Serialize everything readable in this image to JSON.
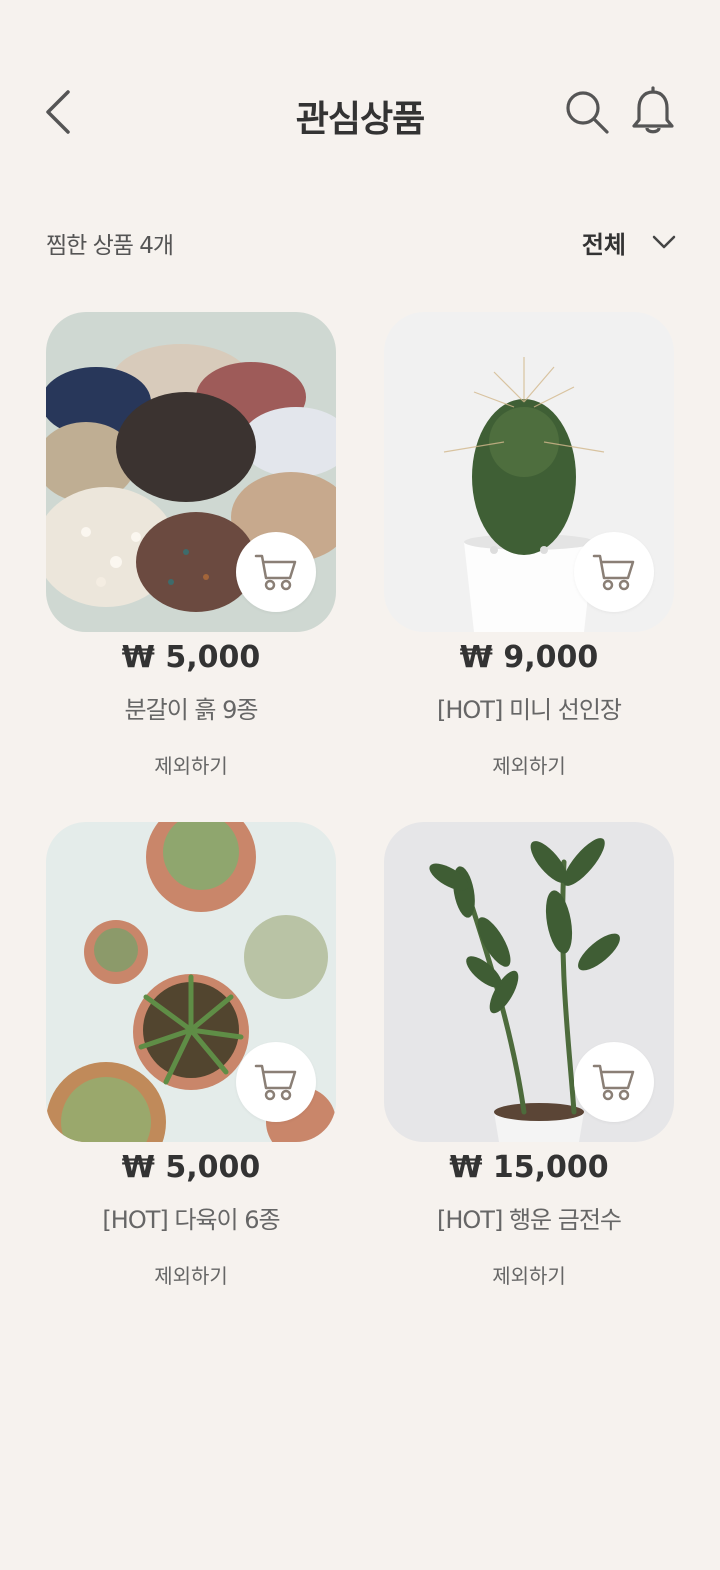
{
  "header": {
    "title": "관심상품",
    "back_icon": "chevron-left-icon",
    "search_icon": "search-icon",
    "notification_icon": "bell-icon"
  },
  "summary": {
    "count_text": "찜한 상품 4개",
    "filter_label": "전체",
    "filter_icon": "chevron-down-icon"
  },
  "products": [
    {
      "price": "₩ 5,000",
      "name": "분갈이 흙 9종",
      "remove_label": "제외하기",
      "image": "soil-mix-photo"
    },
    {
      "price": "₩ 9,000",
      "name": "[HOT] 미니 선인장",
      "remove_label": "제외하기",
      "image": "cactus-photo"
    },
    {
      "price": "₩ 5,000",
      "name": "[HOT] 다육이 6종",
      "remove_label": "제외하기",
      "image": "succulents-photo"
    },
    {
      "price": "₩ 15,000",
      "name": "[HOT] 행운 금전수",
      "remove_label": "제외하기",
      "image": "zz-plant-photo"
    }
  ],
  "colors": {
    "background": "#f6f2ee",
    "text": "#333333",
    "icon": "#555555",
    "cart_icon": "#8a7f76"
  }
}
